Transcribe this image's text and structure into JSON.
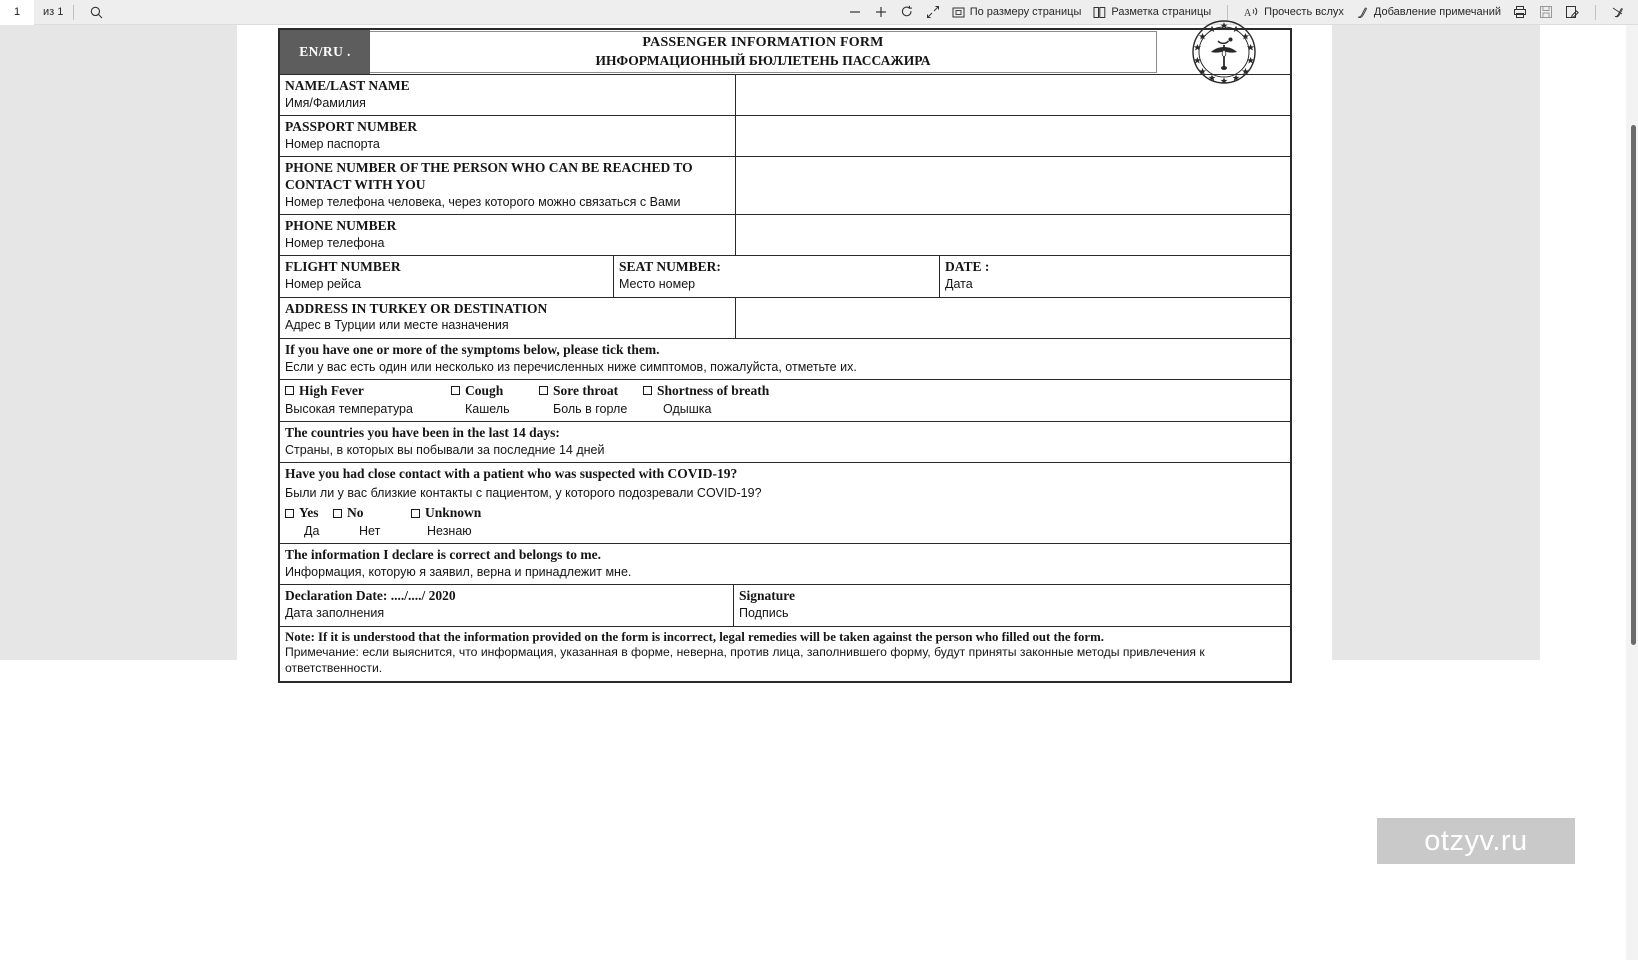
{
  "toolbar": {
    "current_page": "1",
    "page_count_label": "из 1",
    "search_icon": "search-icon",
    "zoom_out_icon": "zoom-out-icon",
    "zoom_in_icon": "zoom-in-icon",
    "rotate_icon": "rotate-icon",
    "fullscreen_icon": "fullscreen-icon",
    "fit_page_label": "По размеру страницы",
    "fit_page_icon": "fit-page-icon",
    "page_layout_label": "Разметка страницы",
    "page_layout_icon": "page-layout-icon",
    "read_aloud_label": "Прочесть вслух",
    "read_aloud_icon": "read-aloud-icon",
    "add_notes_label": "Добавление примечаний",
    "add_notes_icon": "pen-icon",
    "print_icon": "print-icon",
    "save_icon": "save-icon",
    "draw_icon": "draw-icon",
    "highlight_icon": "highlighter-icon"
  },
  "document": {
    "lang_badge": "EN/RU .",
    "title_en": "PASSENGER INFORMATION FORM",
    "title_ru": "ИНФОРМАЦИОННЫЙ БЮЛЛЕТЕНЬ ПАССАЖИРА",
    "seal_icon": "ministry-of-health-seal-icon",
    "fields": [
      {
        "en": "NAME/LAST NAME",
        "ru": "Имя/Фамилия"
      },
      {
        "en": "PASSPORT NUMBER",
        "ru": "Номер паспорта"
      },
      {
        "en": "PHONE NUMBER OF  THE PERSON WHO CAN BE REACHED TO CONTACT WITH YOU",
        "ru": "Номер телефона человека, через которого можно связаться с Вами"
      },
      {
        "en": "PHONE NUMBER",
        "ru": "Номер телефона"
      }
    ],
    "flight_row": [
      {
        "en": "FLIGHT NUMBER",
        "ru": "Номер рейса"
      },
      {
        "en": "SEAT NUMBER:",
        "ru": "Место номер"
      },
      {
        "en": "DATE :",
        "ru": "Дата"
      }
    ],
    "address": {
      "en": "ADDRESS IN TURKEY OR DESTINATION",
      "ru": "Адрес в Турции или месте назначения"
    },
    "symptoms_prompt": {
      "en": "If you have one or more of the symptoms below, please tick them.",
      "ru": "Если у вас есть один или несколько из перечисленных ниже симптомов, пожалуйста, отметьте их."
    },
    "symptoms": [
      {
        "en": "High Fever",
        "ru": "Высокая температура"
      },
      {
        "en": "Cough",
        "ru": "Кашель"
      },
      {
        "en": "Sore throat",
        "ru": "Боль в горле"
      },
      {
        "en": "Shortness of breath",
        "ru": "Одышка"
      }
    ],
    "countries": {
      "en": "The countries you have been in the last 14 days:",
      "ru": "Страны, в которых вы побывали за последние 14 дней"
    },
    "contact_question": {
      "en": "Have you had close contact with a patient who was suspected with COVID-19?",
      "ru": "Были ли у вас близкие контакты с пациентом, у которого подозревали COVID-19?"
    },
    "contact_answers": [
      {
        "en": "Yes",
        "ru": "Да"
      },
      {
        "en": "No",
        "ru": "Нет"
      },
      {
        "en": "Unknown",
        "ru": "Незнаю"
      }
    ],
    "declaration": {
      "en": "The information I declare is correct and belongs to me.",
      "ru": "Информация, которую я заявил, верна и принадлежит мне."
    },
    "declaration_date": {
      "en": "Declaration Date: ..../..../ 2020",
      "ru": "Дата заполнения"
    },
    "signature": {
      "en": "Signature",
      "ru": "Подпись"
    },
    "note": {
      "en": "Note: If it is understood that the information provided on the form is incorrect, legal remedies will be taken against the person who filled out the form.",
      "ru": "Примечание: если выяснится, что информация, указанная в форме, неверна, против лица, заполнившего форму, будут приняты законные методы привлечения к ответственности."
    }
  },
  "watermark": {
    "text": "otzyv.ru"
  }
}
